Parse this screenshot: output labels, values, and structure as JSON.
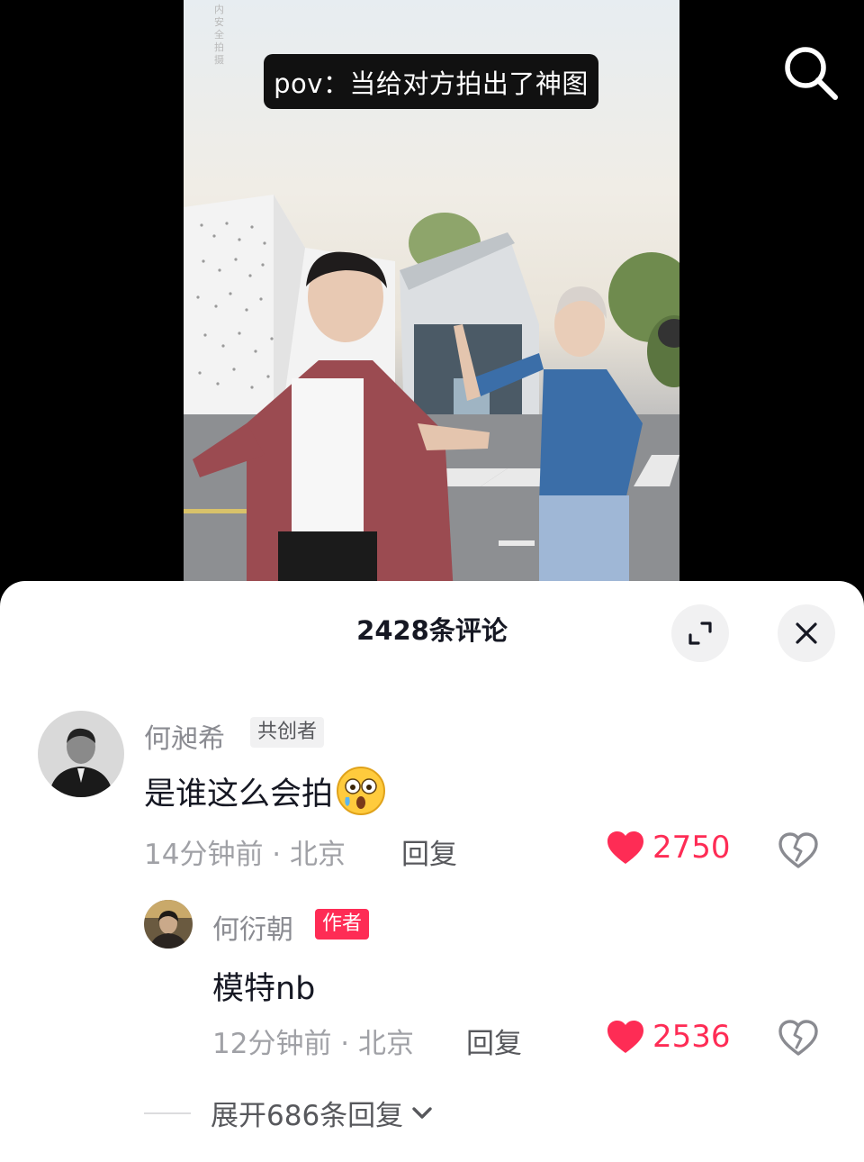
{
  "video": {
    "watermark": "内安全拍摄",
    "caption": "pov：当给对方拍出了神图"
  },
  "icons": {
    "search": "search-icon",
    "expand": "expand-icon",
    "close": "close-icon",
    "heart": "heart-icon",
    "dislike": "broken-heart-icon",
    "chevron": "chevron-down-icon",
    "emoji": "surprised-emoji-icon"
  },
  "comments_sheet": {
    "title": "2428条评论",
    "comments": [
      {
        "username": "何昶希",
        "badge": "共创者",
        "text": "是谁这么会拍",
        "time_location": "14分钟前 · 北京",
        "reply_label": "回复",
        "likes": "2750"
      }
    ],
    "replies": [
      {
        "username": "何衍朝",
        "badge": "作者",
        "text": "模特nb",
        "time_location": "12分钟前 · 北京",
        "reply_label": "回复",
        "likes": "2536"
      }
    ],
    "expand_label": "展开686条回复"
  },
  "colors": {
    "accent": "#fe2c55",
    "primary_text": "#161823",
    "secondary_text": "#8a8b91"
  }
}
